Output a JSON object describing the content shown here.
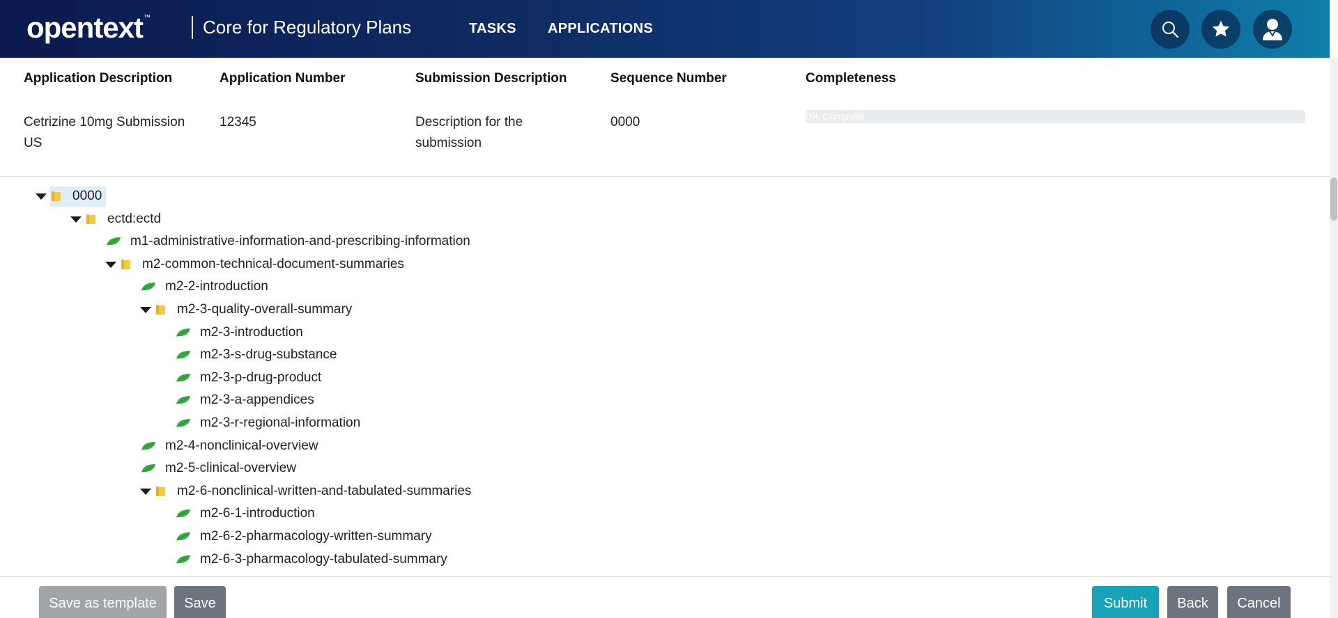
{
  "header": {
    "logo_text": "opentext",
    "logo_tm": "™",
    "app_title": "Core for Regulatory Plans",
    "nav": {
      "tasks": "TASKS",
      "applications": "APPLICATIONS"
    },
    "icons": [
      "search-icon",
      "star-icon",
      "user-icon"
    ]
  },
  "info": {
    "columns": [
      {
        "heading": "Application Description",
        "value": "Cetrizine 10mg Submission US"
      },
      {
        "heading": "Application Number",
        "value": "12345"
      },
      {
        "heading": "Submission Description",
        "value": "Description for the submission"
      },
      {
        "heading": "Sequence Number",
        "value": "0000"
      },
      {
        "heading": "Completeness"
      }
    ],
    "completeness": {
      "percent": 0,
      "label": "0% Complete"
    }
  },
  "tree": {
    "nodes": [
      {
        "label": "0000",
        "type": "folder",
        "expanded": true,
        "selected": true
      },
      {
        "label": "ectd:ectd",
        "type": "folder",
        "expanded": true
      },
      {
        "label": "m1-administrative-information-and-prescribing-information",
        "type": "leaf"
      },
      {
        "label": "m2-common-technical-document-summaries",
        "type": "folder",
        "expanded": true
      },
      {
        "label": "m2-2-introduction",
        "type": "leaf"
      },
      {
        "label": "m2-3-quality-overall-summary",
        "type": "folder",
        "expanded": true
      },
      {
        "label": "m2-3-introduction",
        "type": "leaf"
      },
      {
        "label": "m2-3-s-drug-substance",
        "type": "leaf"
      },
      {
        "label": "m2-3-p-drug-product",
        "type": "leaf"
      },
      {
        "label": "m2-3-a-appendices",
        "type": "leaf"
      },
      {
        "label": "m2-3-r-regional-information",
        "type": "leaf"
      },
      {
        "label": "m2-4-nonclinical-overview",
        "type": "leaf"
      },
      {
        "label": "m2-5-clinical-overview",
        "type": "leaf"
      },
      {
        "label": "m2-6-nonclinical-written-and-tabulated-summaries",
        "type": "folder",
        "expanded": true
      },
      {
        "label": "m2-6-1-introduction",
        "type": "leaf"
      },
      {
        "label": "m2-6-2-pharmacology-written-summary",
        "type": "leaf"
      },
      {
        "label": "m2-6-3-pharmacology-tabulated-summary",
        "type": "leaf"
      }
    ]
  },
  "footer": {
    "save_as_template": "Save as template",
    "save": "Save",
    "submit": "Submit",
    "back": "Back",
    "cancel": "Cancel"
  },
  "colors": {
    "leaf": "#3aa845",
    "folder": "#f3c94a",
    "submit": "#17a2b8",
    "secondary": "#6c757d"
  }
}
